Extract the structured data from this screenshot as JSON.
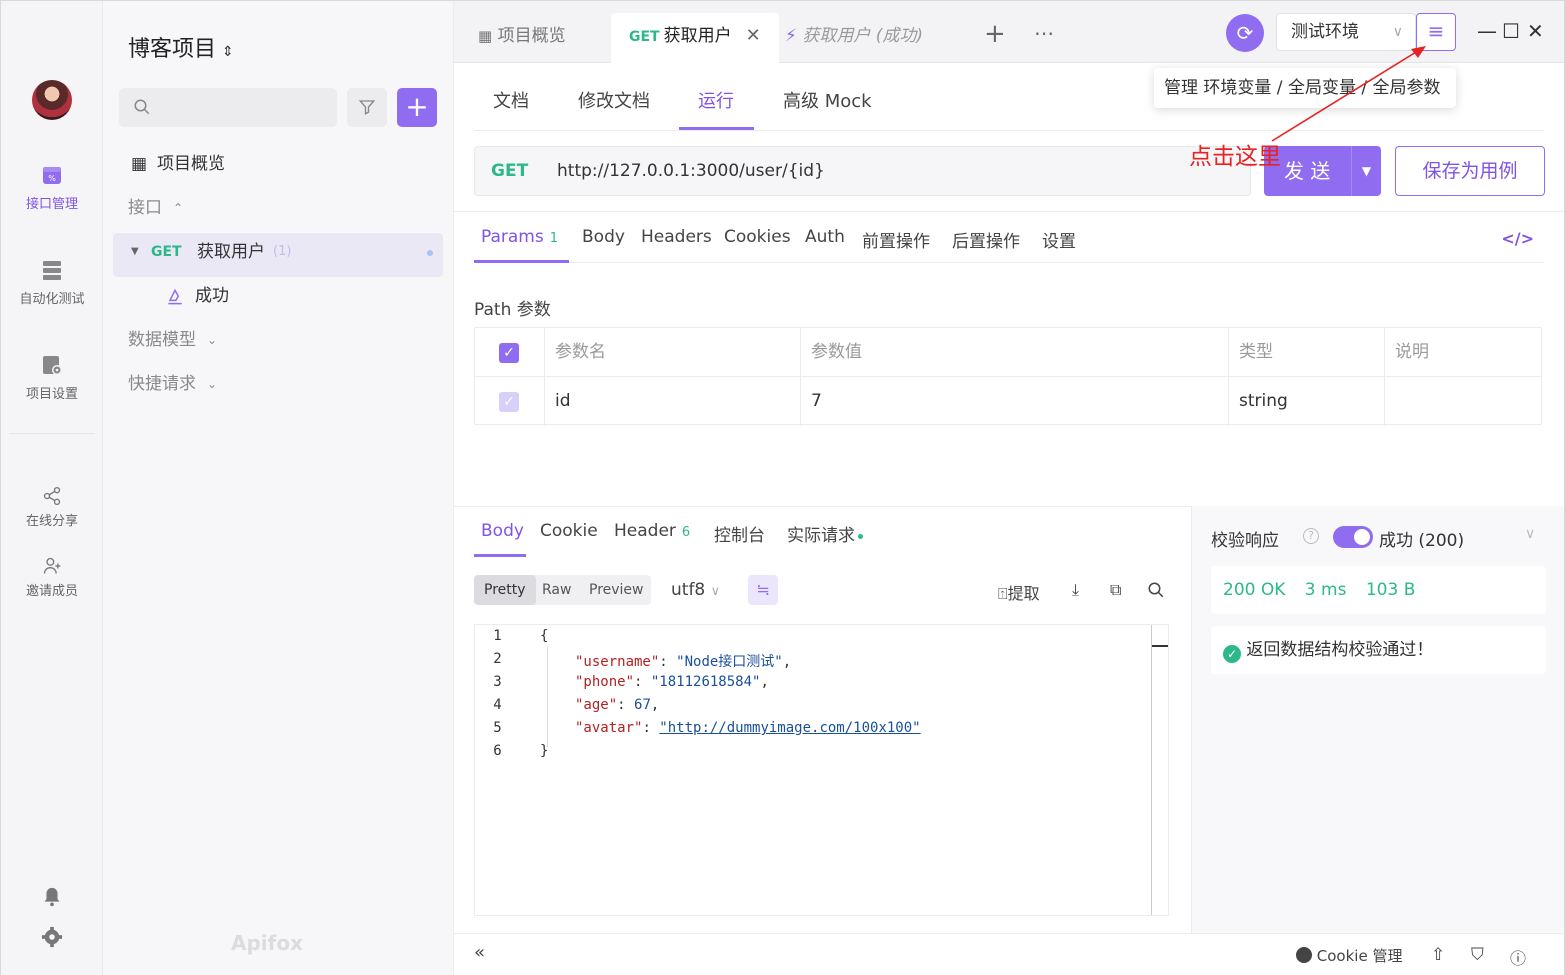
{
  "sidebar_rail": {
    "items": [
      {
        "label": "接口管理",
        "icon": "api-management-icon"
      },
      {
        "label": "自动化测试",
        "icon": "automation-test-icon"
      },
      {
        "label": "项目设置",
        "icon": "project-settings-icon"
      },
      {
        "label": "在线分享",
        "icon": "share-icon"
      },
      {
        "label": "邀请成员",
        "icon": "invite-member-icon"
      }
    ]
  },
  "project": {
    "title": "博客项目",
    "caret": "⌃⌄",
    "search_placeholder": ""
  },
  "tree": {
    "overview": "项目概览",
    "api_group": "接口",
    "api_item": {
      "method": "GET",
      "name": "获取用户",
      "count": "(1)"
    },
    "case_item": "成功",
    "models": "数据模型",
    "quick": "快捷请求"
  },
  "brand": "Apifox",
  "tabs": [
    {
      "label": "项目概览"
    },
    {
      "method": "GET",
      "label": "获取用户"
    },
    {
      "label": "获取用户 (成功)"
    }
  ],
  "env": {
    "selected": "测试环境"
  },
  "tooltip": "管理 环境变量 / 全局变量 / 全局参数",
  "annotation": "点击这里",
  "subtabs": [
    "文档",
    "修改文档",
    "运行",
    "高级 Mock"
  ],
  "request": {
    "method": "GET",
    "url": "http://127.0.0.1:3000/user/{id}",
    "send": "发 送",
    "save": "保存为用例"
  },
  "param_tabs": [
    {
      "label": "Params",
      "count": "1"
    },
    {
      "label": "Body"
    },
    {
      "label": "Headers"
    },
    {
      "label": "Cookies"
    },
    {
      "label": "Auth"
    },
    {
      "label": "前置操作"
    },
    {
      "label": "后置操作"
    },
    {
      "label": "设置"
    }
  ],
  "path_params": {
    "title": "Path 参数",
    "headers": [
      "参数名",
      "参数值",
      "类型",
      "说明"
    ],
    "rows": [
      {
        "name": "id",
        "value": "7",
        "type": "string",
        "desc": ""
      }
    ]
  },
  "response_tabs": [
    {
      "label": "Body"
    },
    {
      "label": "Cookie"
    },
    {
      "label": "Header",
      "count": "6"
    },
    {
      "label": "控制台"
    },
    {
      "label": "实际请求"
    }
  ],
  "view_modes": [
    "Pretty",
    "Raw",
    "Preview"
  ],
  "encoding": "utf8",
  "tools": {
    "extract": "提取"
  },
  "code_lines": [
    {
      "n": "1",
      "text": "{"
    },
    {
      "n": "2",
      "key": "\"username\"",
      "val": "\"Node接口测试\""
    },
    {
      "n": "3",
      "key": "\"phone\"",
      "val": "\"18112618584\""
    },
    {
      "n": "4",
      "key": "\"age\"",
      "val": "67"
    },
    {
      "n": "5",
      "key": "\"avatar\"",
      "val": "\"http://dummyimage.com/100x100\""
    },
    {
      "n": "6",
      "text": "}"
    }
  ],
  "verify": {
    "label": "校验响应",
    "result": "成功 (200)",
    "status": "200 OK",
    "time": "3 ms",
    "size": "103 B",
    "message": "返回数据结构校验通过！"
  },
  "footer": {
    "cookie": "Cookie 管理"
  }
}
